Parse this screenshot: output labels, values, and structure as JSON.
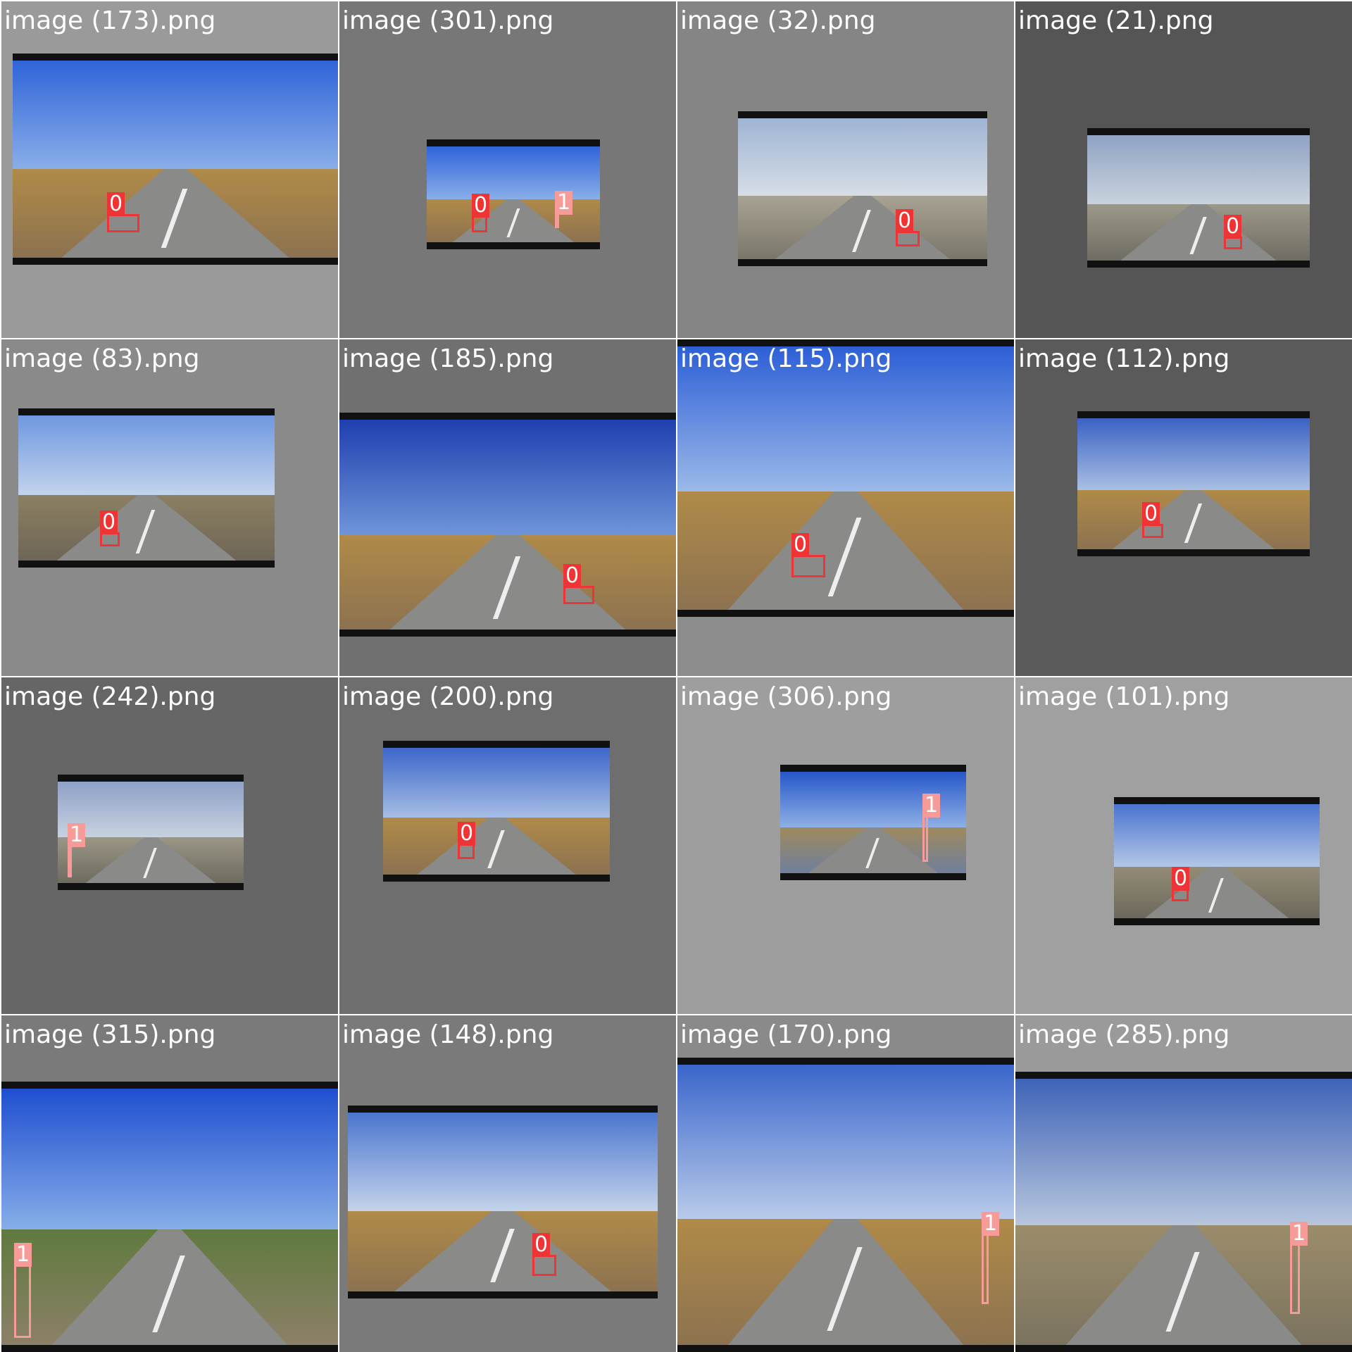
{
  "tiles": [
    {
      "title": "image (173).png",
      "label": "0",
      "bg": "#9a9a9a",
      "cls": "c0"
    },
    {
      "title": "image (301).png",
      "labels": [
        "0",
        "1"
      ],
      "bg": "#777777"
    },
    {
      "title": "image (32).png",
      "label": "0",
      "bg": "#858585",
      "cls": "c0"
    },
    {
      "title": "image (21).png",
      "label": "0",
      "bg": "#555555",
      "cls": "c0"
    },
    {
      "title": "image (83).png",
      "label": "0",
      "bg": "#8a8a8a",
      "cls": "c0"
    },
    {
      "title": "image (185).png",
      "label": "0",
      "bg": "#707070",
      "cls": "c0"
    },
    {
      "title": "image (115).png",
      "label": "0",
      "bg": "#8c8c8c",
      "cls": "c0"
    },
    {
      "title": "image (112).png",
      "label": "0",
      "bg": "#5a5a5a",
      "cls": "c0"
    },
    {
      "title": "image (242).png",
      "label": "1",
      "bg": "#666666",
      "cls": "c1"
    },
    {
      "title": "image (200).png",
      "label": "0",
      "bg": "#6e6e6e",
      "cls": "c0"
    },
    {
      "title": "image (306).png",
      "label": "1",
      "bg": "#9e9e9e",
      "cls": "c1"
    },
    {
      "title": "image (101).png",
      "label": "0",
      "bg": "#a0a0a0",
      "cls": "c0"
    },
    {
      "title": "image (315).png",
      "label": "1",
      "bg": "#7a7a7a",
      "cls": "c1"
    },
    {
      "title": "image (148).png",
      "label": "0",
      "bg": "#7a7a7a",
      "cls": "c0"
    },
    {
      "title": "image (170).png",
      "label": "1",
      "bg": "#8a8a8a",
      "cls": "c1"
    },
    {
      "title": "image (285).png",
      "label": "1",
      "bg": "#9a9a9a",
      "cls": "c1"
    }
  ],
  "colors": {
    "class_0": "#ee3434",
    "class_1": "#f79b98"
  }
}
